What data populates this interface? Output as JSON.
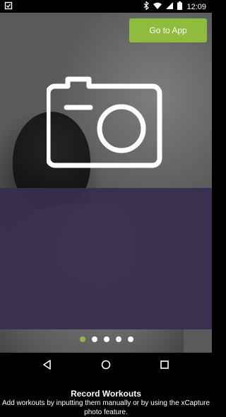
{
  "status_bar": {
    "time": "12:09",
    "icons": [
      "clipboard-check-icon",
      "bluetooth-icon",
      "wifi-icon",
      "signal-icon",
      "battery-icon"
    ]
  },
  "header": {
    "go_to_app_label": "Go to App"
  },
  "slide": {
    "icon": "camera-icon",
    "title": "Record Workouts",
    "description_line1": "Add workouts by inputting them manually or by using the xCapture",
    "description_line2": "photo feature."
  },
  "pager": {
    "count": 5,
    "active_index": 0
  },
  "colors": {
    "accent": "#8fbb3e",
    "panel": "#3a2e4e"
  },
  "nav_bar": {
    "buttons": [
      "back-icon",
      "home-icon",
      "recents-icon"
    ]
  }
}
